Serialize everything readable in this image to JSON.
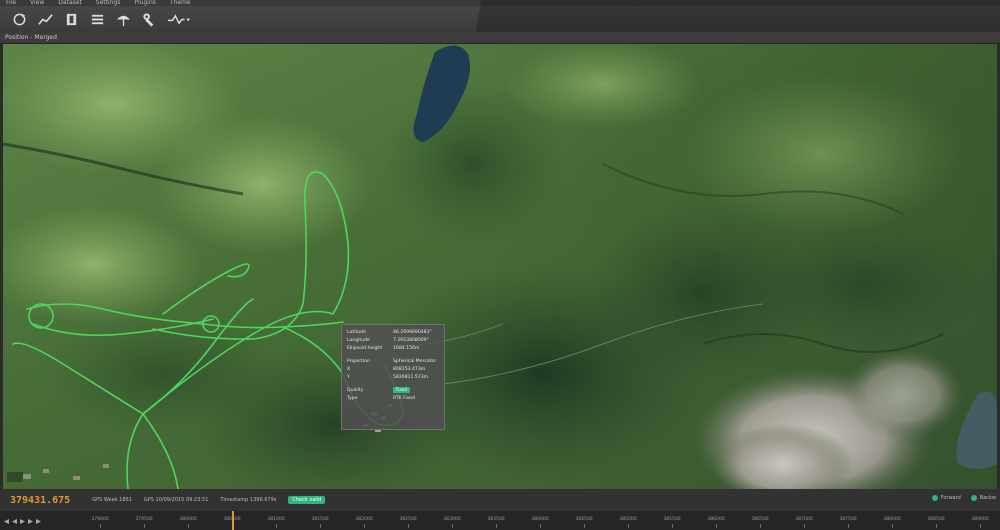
{
  "menu": [
    "File",
    "View",
    "Dataset",
    "Settings",
    "Plugins",
    "Theme"
  ],
  "toolbar": {
    "icons": [
      "rotate-icon",
      "trend-icon",
      "layer-icon",
      "list-icon",
      "umbrella-icon",
      "wrench-icon",
      "wave-icon"
    ]
  },
  "view_title": "Position - Merged",
  "popup": {
    "latitude_label": "Latitude",
    "latitude_value": "46.2696690483°",
    "longitude_label": "Longitude",
    "longitude_value": "7.2653808009°",
    "height_label": "Ellipsoid height",
    "height_value": "1684.156m",
    "projection_label": "Projection",
    "projection_value": "Spherical Mercator",
    "x_label": "X",
    "x_value": "808153.473m",
    "y_label": "Y",
    "y_value": "5826811.573m",
    "quality_label": "Quality",
    "quality_value": "Fixed",
    "type_label": "Type",
    "type_value": "RTK Fixed"
  },
  "status": {
    "time_value": "379431.675",
    "gps_week": "GPS Week 1861",
    "gps_date": "GPS 10/09/2015 09:23:51",
    "timestamp": "Timestamp 1396.679s",
    "check": "Check valid",
    "forward": "Forward",
    "backward": "Backw"
  },
  "timeline": {
    "ticks": [
      "379000",
      "379500",
      "380000",
      "380500",
      "381000",
      "381500",
      "382000",
      "382500",
      "383000",
      "383500",
      "384000",
      "384500",
      "385000",
      "385500",
      "386000",
      "386500",
      "387000",
      "387500",
      "388000",
      "388500",
      "389000"
    ]
  },
  "colors": {
    "track": "#4fd65f",
    "accent": "#e09a35",
    "valid": "#2fb67a"
  }
}
